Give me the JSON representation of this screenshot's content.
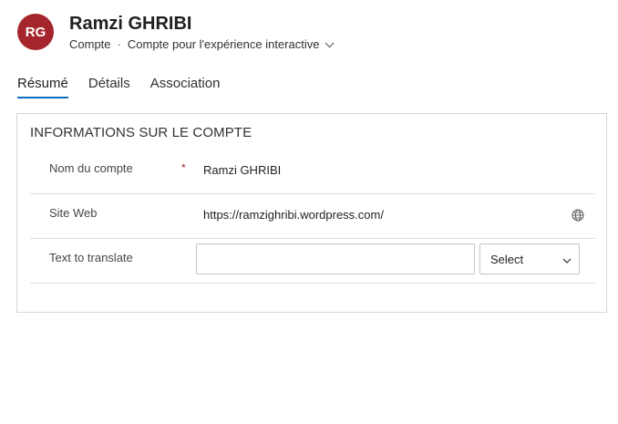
{
  "header": {
    "avatar_initials": "RG",
    "avatar_color": "#a4262c",
    "title": "Ramzi GHRIBI",
    "entity": "Compte",
    "separator": "·",
    "form_name": "Compte pour l'expérience interactive"
  },
  "tabs": [
    {
      "label": "Résumé",
      "active": true
    },
    {
      "label": "Détails",
      "active": false
    },
    {
      "label": "Association",
      "active": false
    }
  ],
  "section": {
    "title": "INFORMATIONS SUR LE COMPTE",
    "fields": {
      "account_name": {
        "label": "Nom du compte",
        "required_marker": "*",
        "value": "Ramzi GHRIBI"
      },
      "website": {
        "label": "Site Web",
        "value": "https://ramzighribi.wordpress.com/",
        "icon": "globe-icon"
      },
      "translate": {
        "label": "Text to translate",
        "value": "",
        "select_value": "Select"
      }
    }
  },
  "colors": {
    "accent": "#0f6cbd",
    "required": "#a4262c"
  }
}
